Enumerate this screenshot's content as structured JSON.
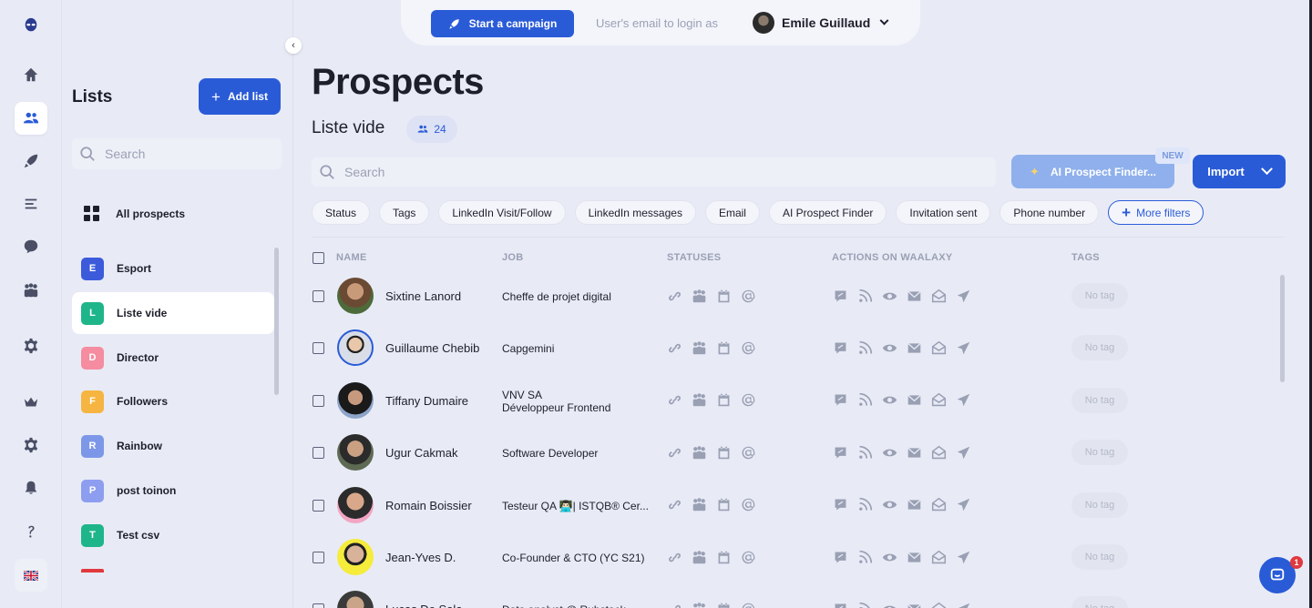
{
  "topbar": {
    "campaign_label": "Start a campaign",
    "login_as": "User's email to login as",
    "user_name": "Emile Guillaud"
  },
  "sidebar": {
    "title": "Lists",
    "add_label": "Add list",
    "search_placeholder": "Search",
    "all_prospects": "All prospects",
    "items": [
      {
        "letter": "E",
        "label": "Esport",
        "color": "#3b5bdb"
      },
      {
        "letter": "L",
        "label": "Liste vide",
        "color": "#1fb58a"
      },
      {
        "letter": "D",
        "label": "Director",
        "color": "#f58ca0"
      },
      {
        "letter": "F",
        "label": "Followers",
        "color": "#f6b541"
      },
      {
        "letter": "R",
        "label": "Rainbow",
        "color": "#7d97e8"
      },
      {
        "letter": "P",
        "label": "post toinon",
        "color": "#8d9ef0"
      },
      {
        "letter": "T",
        "label": "Test csv",
        "color": "#1fb58a"
      }
    ]
  },
  "main": {
    "title": "Prospects",
    "list_name": "Liste vide",
    "count": "24",
    "search_placeholder": "Search",
    "ai_label": "AI Prospect Finder...",
    "new_badge": "NEW",
    "import_label": "Import",
    "filters": [
      "Status",
      "Tags",
      "LinkedIn Visit/Follow",
      "LinkedIn messages",
      "Email",
      "AI Prospect Finder",
      "Invitation sent",
      "Phone number"
    ],
    "more_filters": "More filters"
  },
  "table": {
    "headers": {
      "name": "NAME",
      "job": "JOB",
      "statuses": "STATUSES",
      "actions": "ACTIONS ON WAALAXY",
      "tags": "TAGS"
    },
    "no_tag": "No tag",
    "rows": [
      {
        "name": "Sixtine Lanord",
        "job1": "Cheffe de projet digital",
        "job2": ""
      },
      {
        "name": "Guillaume Chebib",
        "job1": "Capgemini",
        "job2": ""
      },
      {
        "name": "Tiffany Dumaire",
        "job1": "VNV SA",
        "job2": "Développeur Frontend"
      },
      {
        "name": "Ugur Cakmak",
        "job1": "Software Developer",
        "job2": ""
      },
      {
        "name": "Romain Boissier",
        "job1": "Testeur QA 👨🏻‍💻| ISTQB® Cer...",
        "job2": ""
      },
      {
        "name": "Jean-Yves D.",
        "job1": "Co-Founder & CTO (YC S21)",
        "job2": ""
      },
      {
        "name": "Lucas De Sala",
        "job1": "Data analyst @ Rubstack",
        "job2": ""
      }
    ]
  },
  "chat": {
    "badge": "1"
  },
  "colors": {
    "accent": "#2a5bd7",
    "background": "#e8ebf6"
  }
}
